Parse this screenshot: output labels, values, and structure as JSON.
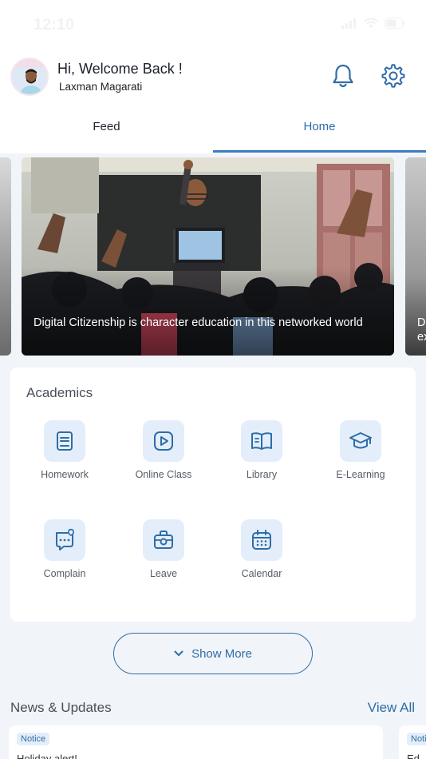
{
  "status_bar": {
    "time": "12:10"
  },
  "header": {
    "greeting": "Hi, Welcome Back !",
    "username": "Laxman Magarati"
  },
  "tabs": [
    {
      "label": "Feed",
      "active": false
    },
    {
      "label": "Home",
      "active": true
    }
  ],
  "carousel": {
    "slides": [
      {
        "caption": "Digital Citizenship is character education in this networked world"
      },
      {
        "caption": "D\nex"
      }
    ]
  },
  "academics": {
    "title": "Academics",
    "items": [
      {
        "label": "Homework",
        "icon": "homework-icon"
      },
      {
        "label": "Online Class",
        "icon": "online-class-icon"
      },
      {
        "label": "Library",
        "icon": "library-icon"
      },
      {
        "label": "E-Learning",
        "icon": "e-learning-icon"
      },
      {
        "label": "Complain",
        "icon": "complain-icon"
      },
      {
        "label": "Leave",
        "icon": "leave-icon"
      },
      {
        "label": "Calendar",
        "icon": "calendar-icon"
      }
    ]
  },
  "show_more": {
    "label": "Show More"
  },
  "news": {
    "title": "News & Updates",
    "view_all": "View All",
    "cards": [
      {
        "badge": "Notice",
        "text": "Holiday alert!"
      },
      {
        "badge": "Noti",
        "text": "Ed"
      }
    ]
  },
  "colors": {
    "accent": "#2e6da7",
    "icon_bg": "#e4eefa",
    "page_bg": "#f1f4f9"
  }
}
